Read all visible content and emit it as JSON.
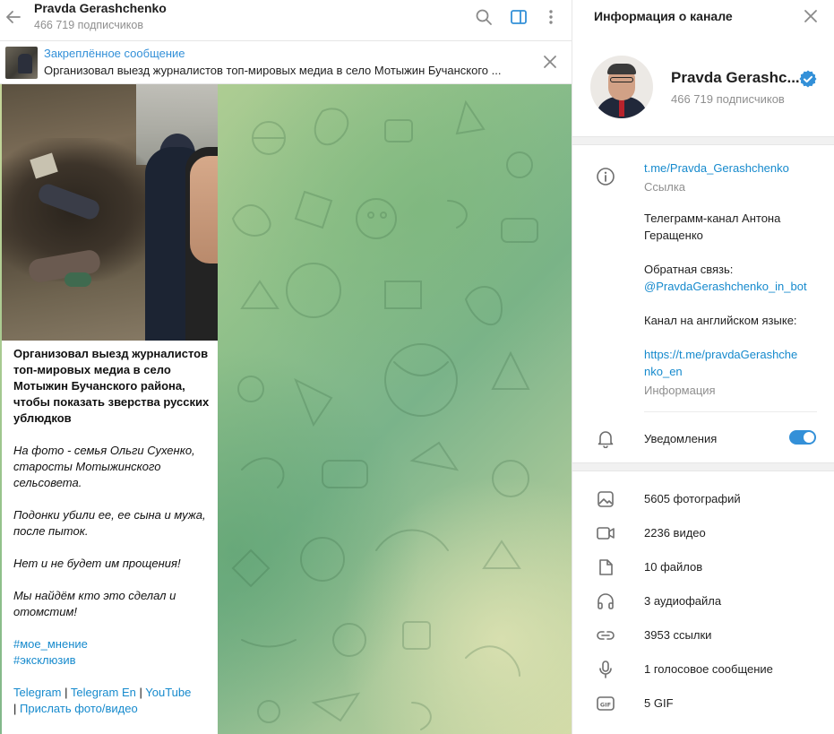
{
  "header": {
    "title": "Pravda Gerashchenko",
    "subtitle": "466 719 подписчиков"
  },
  "pinned": {
    "title": "Закреплённое сообщение",
    "text": "Организовал выезд журналистов топ-мировых медиа в село Мотыжин Бучанского ..."
  },
  "message": {
    "bold_text": "Организовал выезд журналистов топ-мировых медиа в село Мотыжин Бучанского района, чтобы показать зверства русских ублюдков",
    "italic_1": "На фото - семья Ольги Сухенко, старосты Мотыжинского сельсовета.",
    "italic_2": "Подонки убили ее, ее сына и мужа, после пыток.",
    "italic_3": "Нет и не будет им прощения!",
    "italic_4": "Мы найдём кто это сделал и отомстим!",
    "hashtag_1": "#мое_мнение",
    "hashtag_2": "#эксклюзив",
    "footer_links": [
      "Telegram",
      "Telegram En",
      "YouTube",
      "Прислать фото/видео"
    ],
    "separator": "|"
  },
  "panel": {
    "title": "Информация о канале",
    "name": "Pravda Gerashc...",
    "subscribers": "466 719 подписчиков",
    "link": "t.me/Pravda_Gerashchenko",
    "link_label": "Ссылка",
    "description_1": "Телеграмм-канал Антона Геращенко",
    "feedback_label": "Обратная связь:",
    "feedback_bot": "@PravdaGerashchenko_in_bot",
    "english_label": "Канал на английском языке:",
    "english_link_1": "https://t.me/pravdaGerashche",
    "english_link_2": "nko_en",
    "info_label": "Информация",
    "notifications_label": "Уведомления",
    "notifications_on": true
  },
  "media": [
    {
      "label": "5605 фотографий",
      "icon": "photo-icon"
    },
    {
      "label": "2236 видео",
      "icon": "video-icon"
    },
    {
      "label": "10 файлов",
      "icon": "file-icon"
    },
    {
      "label": "3 аудиофайла",
      "icon": "headphones-icon"
    },
    {
      "label": "3953 ссылки",
      "icon": "link-icon"
    },
    {
      "label": "1 голосовое сообщение",
      "icon": "microphone-icon"
    },
    {
      "label": "5 GIF",
      "icon": "gif-icon"
    }
  ],
  "colors": {
    "accent": "#3390d8",
    "link": "#168acd",
    "muted": "#8f8f8f"
  }
}
